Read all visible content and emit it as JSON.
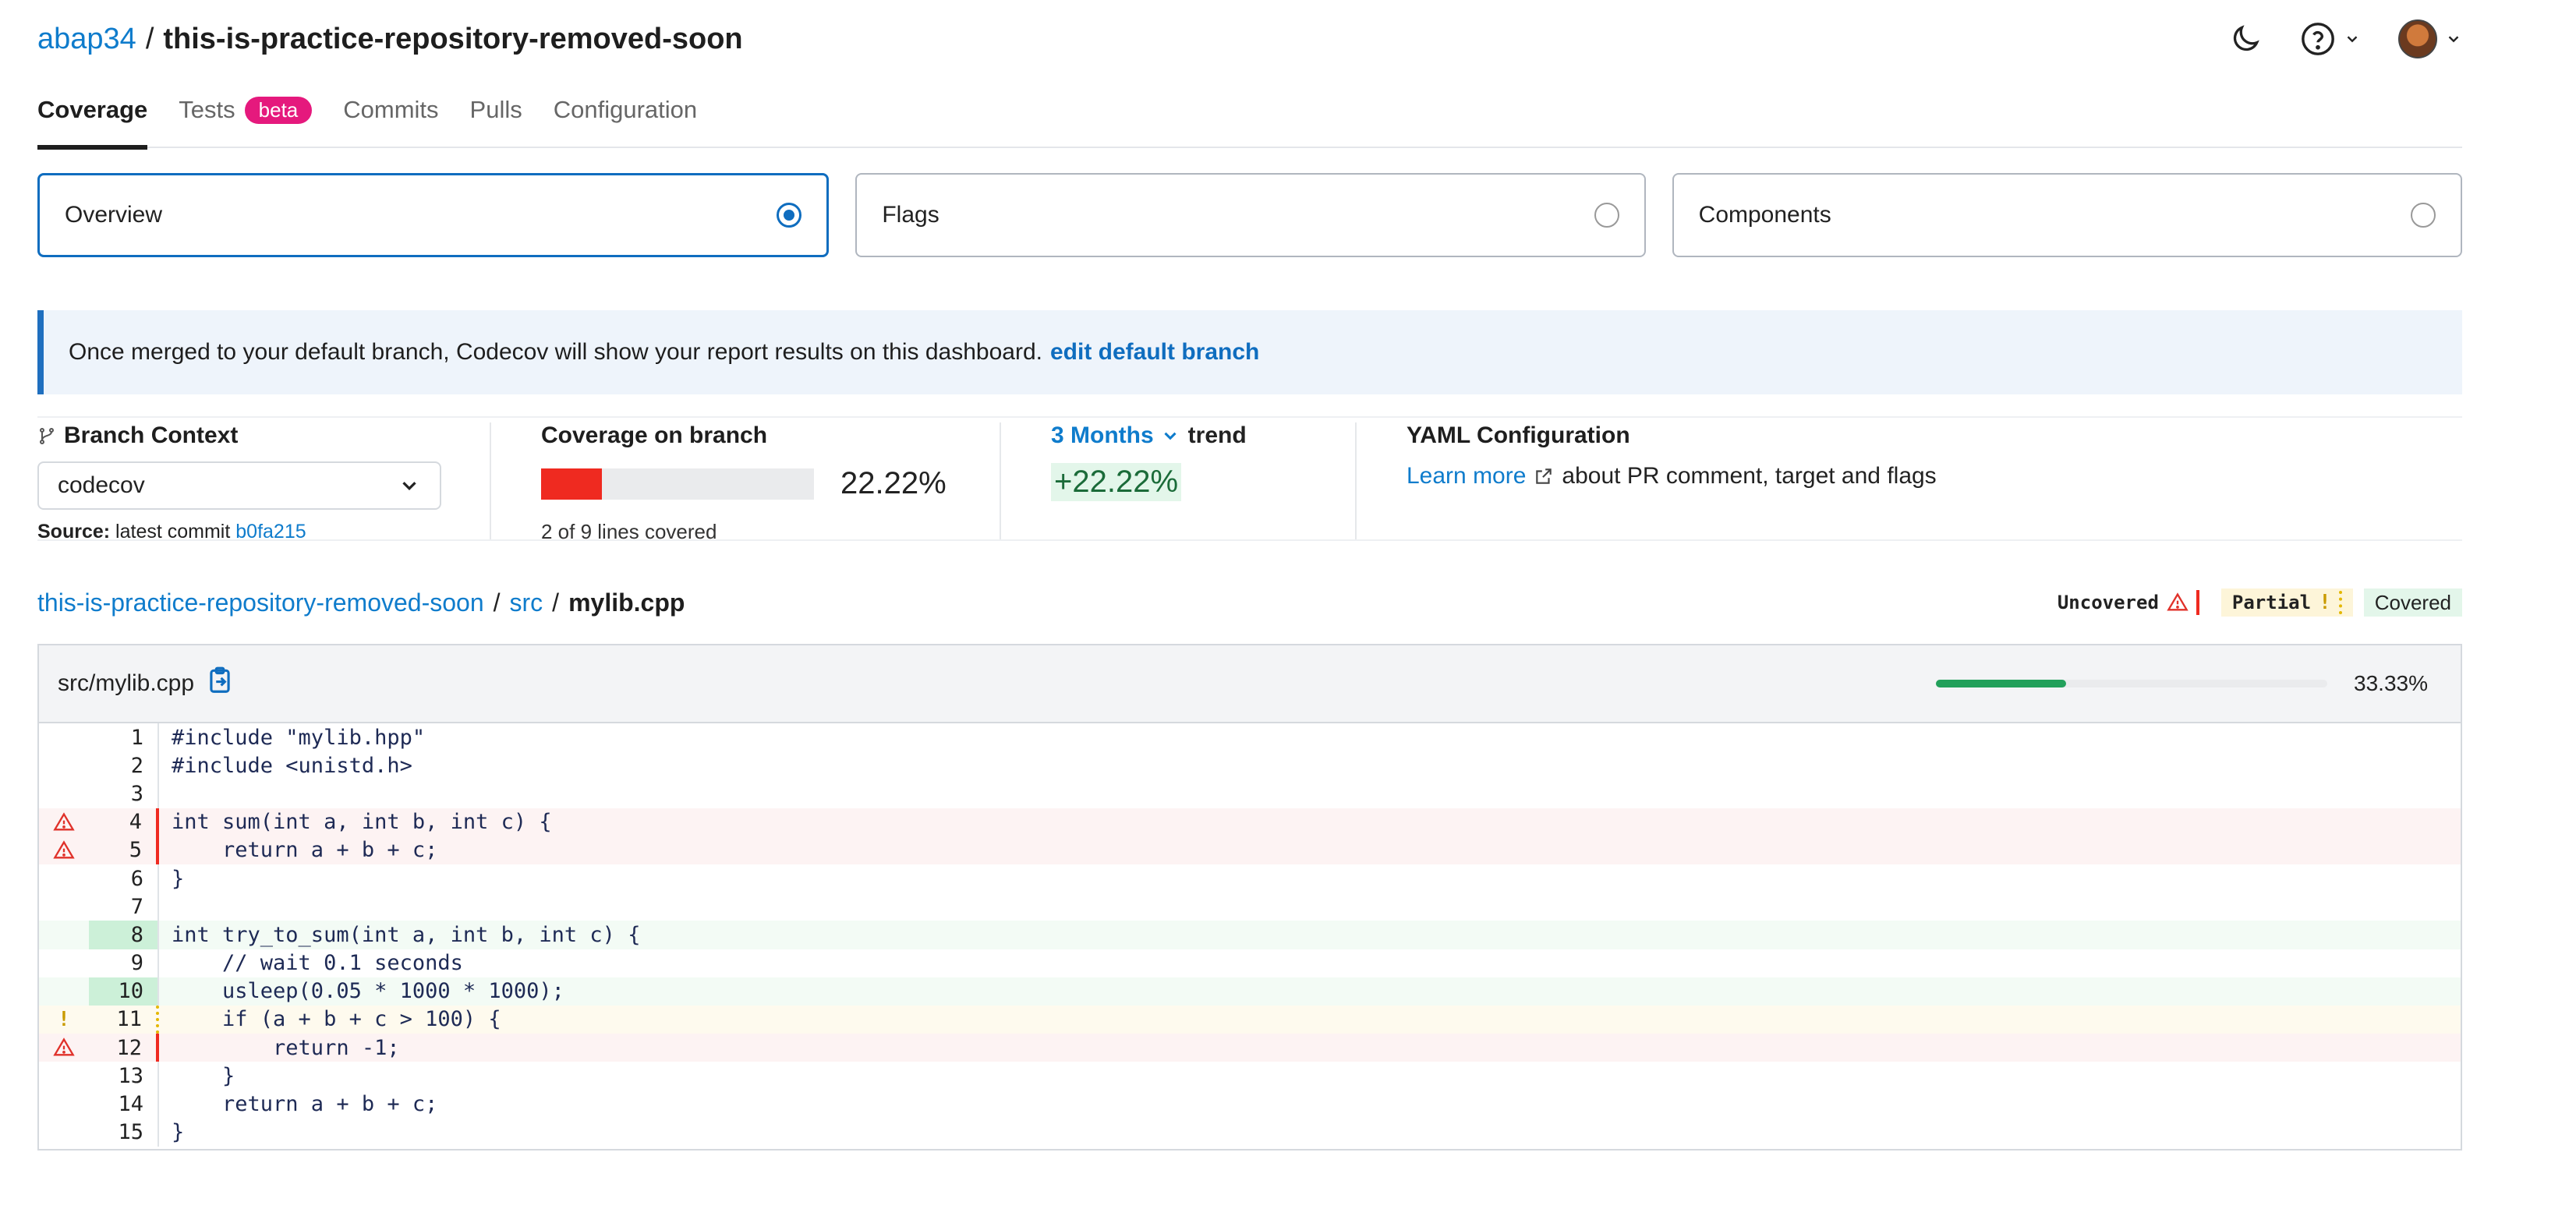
{
  "header": {
    "owner": "abap34",
    "separator": "/",
    "repo": "this-is-practice-repository-removed-soon"
  },
  "tabs": [
    {
      "label": "Coverage"
    },
    {
      "label": "Tests",
      "badge": "beta"
    },
    {
      "label": "Commits"
    },
    {
      "label": "Pulls"
    },
    {
      "label": "Configuration"
    }
  ],
  "cards": [
    {
      "label": "Overview",
      "selected": true
    },
    {
      "label": "Flags",
      "selected": false
    },
    {
      "label": "Components",
      "selected": false
    }
  ],
  "notice": {
    "text": "Once merged to your default branch, Codecov will show your report results on this dashboard.",
    "link": "edit default branch"
  },
  "branch": {
    "title": "Branch Context",
    "selected": "codecov",
    "source_label": "Source:",
    "source_text": "latest commit",
    "commit": "b0fa215"
  },
  "coverage": {
    "title": "Coverage on branch",
    "percent": "22.22%",
    "fraction": 0.2222,
    "lines": "2 of 9 lines covered"
  },
  "trend": {
    "period": "3 Months",
    "label": "trend",
    "value": "+22.22%"
  },
  "yaml": {
    "title": "YAML Configuration",
    "link": "Learn more",
    "text": "about PR comment, target and flags"
  },
  "breadcrumb": {
    "repo": "this-is-practice-repository-removed-soon",
    "dir": "src",
    "file": "mylib.cpp",
    "sep": "/"
  },
  "legend": {
    "uncovered": "Uncovered",
    "partial": "Partial",
    "partial_mark": "!",
    "covered": "Covered"
  },
  "file": {
    "name": "src/mylib.cpp",
    "percent": "33.33%",
    "fraction": 0.3333,
    "lines": [
      {
        "n": "1",
        "code": "#include \"mylib.hpp\"",
        "status": ""
      },
      {
        "n": "2",
        "code": "#include <unistd.h>",
        "status": ""
      },
      {
        "n": "3",
        "code": "",
        "status": ""
      },
      {
        "n": "4",
        "code": "int sum(int a, int b, int c) {",
        "status": "uncov"
      },
      {
        "n": "5",
        "code": "    return a + b + c;",
        "status": "uncov"
      },
      {
        "n": "6",
        "code": "}",
        "status": ""
      },
      {
        "n": "7",
        "code": "",
        "status": ""
      },
      {
        "n": "8",
        "code": "int try_to_sum(int a, int b, int c) {",
        "status": "covered"
      },
      {
        "n": "9",
        "code": "    // wait 0.1 seconds",
        "status": ""
      },
      {
        "n": "10",
        "code": "    usleep(0.05 * 1000 * 1000);",
        "status": "covered"
      },
      {
        "n": "11",
        "code": "    if (a + b + c > 100) {",
        "status": "partial"
      },
      {
        "n": "12",
        "code": "        return -1;",
        "status": "uncov"
      },
      {
        "n": "13",
        "code": "    }",
        "status": ""
      },
      {
        "n": "14",
        "code": "    return a + b + c;",
        "status": ""
      },
      {
        "n": "15",
        "code": "}",
        "status": ""
      }
    ]
  },
  "colors": {
    "link": "#0f7ccc",
    "uncovered": "#ef2a20",
    "covered": "#22a05b",
    "partial": "#e4b700",
    "badge": "#e5197d"
  }
}
